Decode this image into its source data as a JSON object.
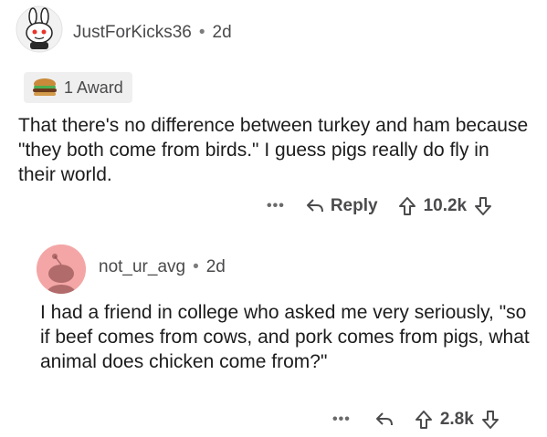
{
  "comment1": {
    "username": "JustForKicks36",
    "age": "2d",
    "separator": "•",
    "award": {
      "count_label": "1 Award",
      "icon": "burger-award-icon"
    },
    "body": "That there's no difference between turkey and ham because \"they both come from birds.\" I guess pigs really do fly in their world.",
    "actions": {
      "more_label": "•••",
      "reply_label": "Reply",
      "score": "10.2k"
    }
  },
  "comment2": {
    "username": "not_ur_avg",
    "age": "2d",
    "separator": "•",
    "body": "I had a friend in college who asked me very seriously, \"so if beef comes from cows, and pork comes from pigs, what animal does chicken come from?\"",
    "actions": {
      "more_label": "•••",
      "score": "2.8k"
    }
  },
  "colors": {
    "avatar2_bg": "#f4a6a6",
    "text": "#1c1c1c",
    "meta": "#4a4a4c",
    "award_bg": "#efefef"
  }
}
